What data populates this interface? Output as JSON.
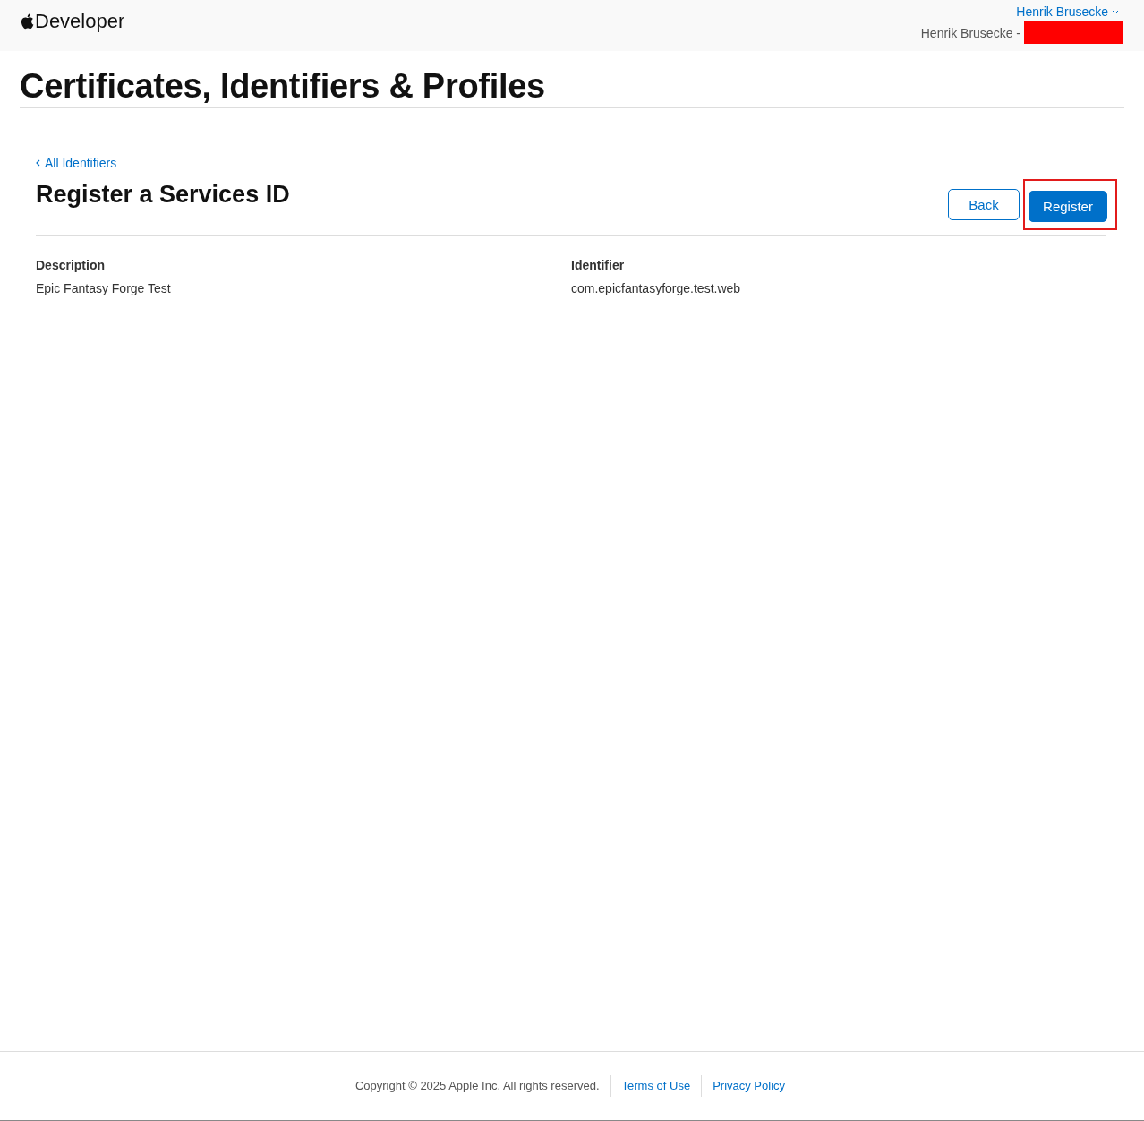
{
  "header": {
    "brand": "Developer",
    "account": {
      "name": "Henrik Brusecke",
      "team": "Henrik Brusecke -",
      "redacted": true
    }
  },
  "page_title": "Certificates, Identifiers & Profiles",
  "back_link": "All Identifiers",
  "heading": "Register a Services ID",
  "buttons": [
    {
      "label": "Back",
      "kind": "secondary",
      "highlighted": false
    },
    {
      "label": "Register",
      "kind": "primary",
      "highlighted": true
    }
  ],
  "fields": [
    {
      "label": "Description",
      "value": "Epic Fantasy Forge Test"
    },
    {
      "label": "Identifier",
      "value": "com.epicfantasyforge.test.web"
    }
  ],
  "footer": {
    "copyright": "Copyright © 2025 Apple Inc. All rights reserved.",
    "links": [
      "Terms of Use",
      "Privacy Policy"
    ]
  }
}
